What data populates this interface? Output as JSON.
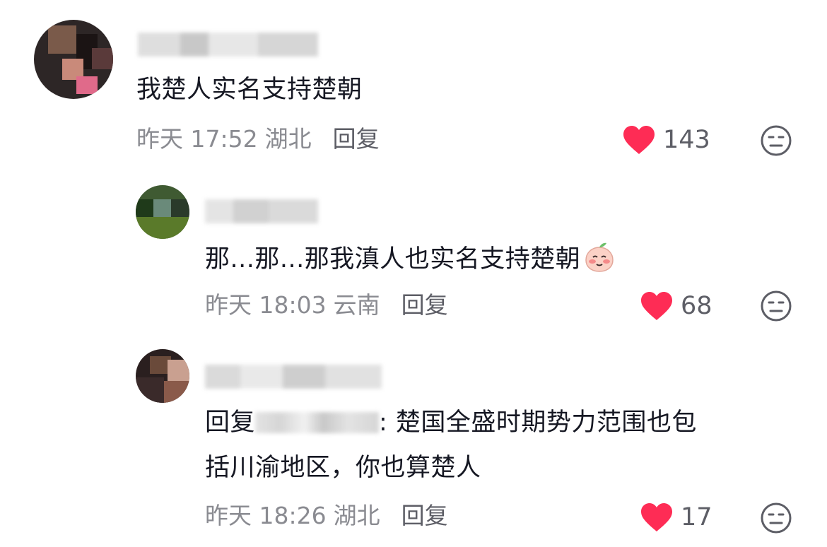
{
  "comments": [
    {
      "text": "我楚人实名支持楚朝",
      "time": "昨天 17:52",
      "location": "湖北",
      "reply_label": "回复",
      "likes": "143"
    },
    {
      "text": "那...那...那我滇人也实名支持楚朝",
      "time": "昨天 18:03",
      "location": "云南",
      "reply_label": "回复",
      "likes": "68"
    },
    {
      "reply_prefix": "回复",
      "text_line1": ": 楚国全盛时期势力范围也包",
      "text_line2": "括川渝地区，你也算楚人",
      "time": "昨天 18:26",
      "location": "湖北",
      "reply_label": "回复",
      "likes": "17"
    }
  ],
  "colors": {
    "heart": "#fe2c55",
    "meta_text": "#8a8b91",
    "main_text": "#161823"
  },
  "icons": {
    "like": "heart-icon",
    "dislike": "dislike-face-icon",
    "emoji": "blushing-peach-emoji"
  }
}
